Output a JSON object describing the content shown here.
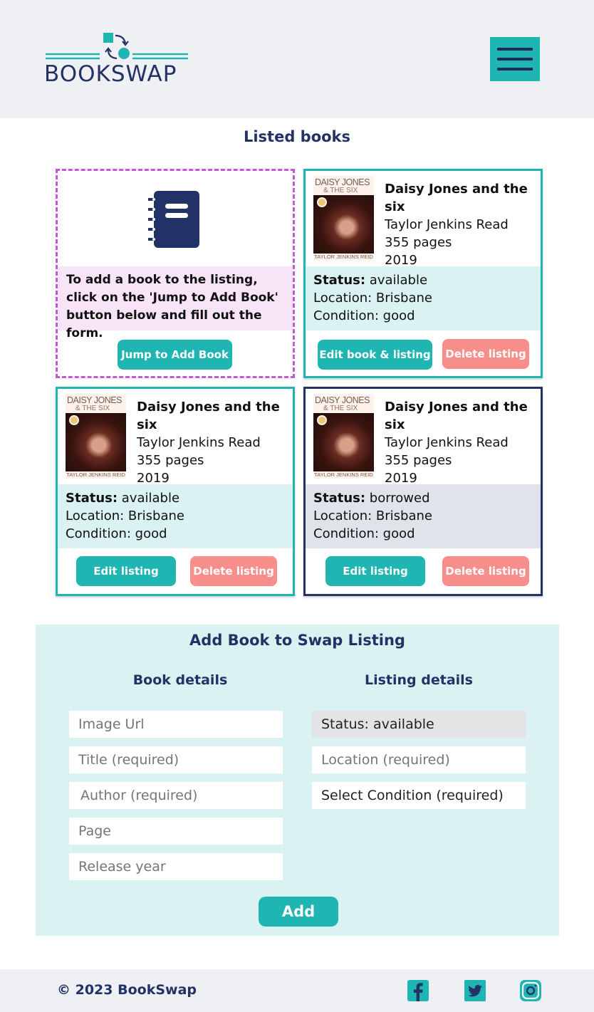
{
  "header": {
    "logo_text": "BOOKSWAP",
    "brand_colors": {
      "teal": "#1fb5b3",
      "navy": "#223266"
    }
  },
  "listing": {
    "title": "Listed books",
    "add_card": {
      "instruction": "To add a book to the listing, click on the 'Jump to Add Book' button below and fill out the form.",
      "jump_button": "Jump to Add Book"
    },
    "books": [
      {
        "cover_title_line1": "DAISY JONES",
        "cover_title_line2": "& THE SIX",
        "cover_author": "TAYLOR JENKINS REID",
        "title": "Daisy Jones and the six",
        "author": "Taylor Jenkins Read",
        "pages": "355 pages",
        "year": "2019",
        "status_label": "Status:",
        "status_value": " available",
        "location": "Location: Brisbane",
        "condition": "Condition: good",
        "edit_button": "Edit book & listing",
        "delete_button": "Delete listing"
      },
      {
        "cover_title_line1": "DAISY JONES",
        "cover_title_line2": "& THE SIX",
        "cover_author": "TAYLOR JENKINS REID",
        "title": "Daisy Jones and the six",
        "author": "Taylor Jenkins Read",
        "pages": "355 pages",
        "year": "2019",
        "status_label": "Status:",
        "status_value": " available",
        "location": "Location: Brisbane",
        "condition": "Condition: good",
        "edit_button": "Edit listing",
        "delete_button": "Delete listing"
      },
      {
        "cover_title_line1": "DAISY JONES",
        "cover_title_line2": "& THE SIX",
        "cover_author": "TAYLOR JENKINS REID",
        "title": "Daisy Jones and the six",
        "author": "Taylor Jenkins Read",
        "pages": "355 pages",
        "year": "2019",
        "status_label": "Status:",
        "status_value": " borrowed",
        "location": "Location: Brisbane",
        "condition": "Condition: good",
        "edit_button": "Edit listing",
        "delete_button": "Delete listing"
      }
    ]
  },
  "form": {
    "title": "Add Book to Swap Listing",
    "book_details_title": "Book details",
    "listing_details_title": "Listing details",
    "image_url_placeholder": "Image Url",
    "title_placeholder": "Title (required)",
    "author_placeholder": "Author (required)",
    "page_placeholder": "Page",
    "release_year_placeholder": "Release year",
    "status_value": "Status: available",
    "location_placeholder": "Location (required)",
    "condition_placeholder": "Select Condition (required)",
    "add_button": "Add"
  },
  "footer": {
    "copyright": "© 2023 BookSwap",
    "social_icons": [
      "facebook-icon",
      "twitter-icon",
      "instagram-icon"
    ]
  }
}
